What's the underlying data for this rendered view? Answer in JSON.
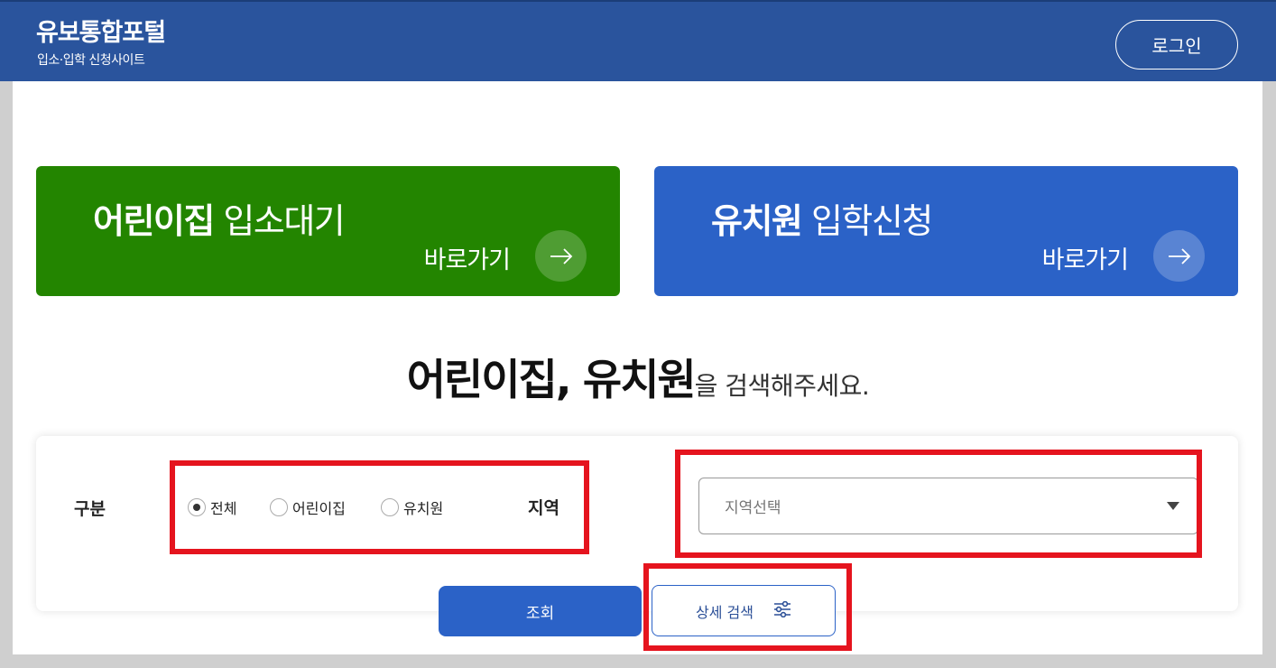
{
  "header": {
    "title": "유보통합포털",
    "subtitle": "입소·입학 신청사이트",
    "login_label": "로그인"
  },
  "cards": [
    {
      "bold": "어린이집",
      "rest": " 입소대기",
      "go": "바로가기",
      "color": "#238500"
    },
    {
      "bold": "유치원",
      "rest": " 입학신청",
      "go": "바로가기",
      "color": "#2b62c7"
    }
  ],
  "search": {
    "heading_bold": "어린이집, 유치원",
    "heading_rest": "을 검색해주세요.",
    "type_label": "구분",
    "types": [
      {
        "label": "전체",
        "checked": true
      },
      {
        "label": "어린이집",
        "checked": false
      },
      {
        "label": "유치원",
        "checked": false
      }
    ],
    "region_label": "지역",
    "region_placeholder": "지역선택",
    "search_button": "조회",
    "detail_button": "상세 검색"
  },
  "colors": {
    "header": "#2a549d",
    "primary": "#2b62c7",
    "green": "#238500",
    "highlight": "#e5141e"
  }
}
